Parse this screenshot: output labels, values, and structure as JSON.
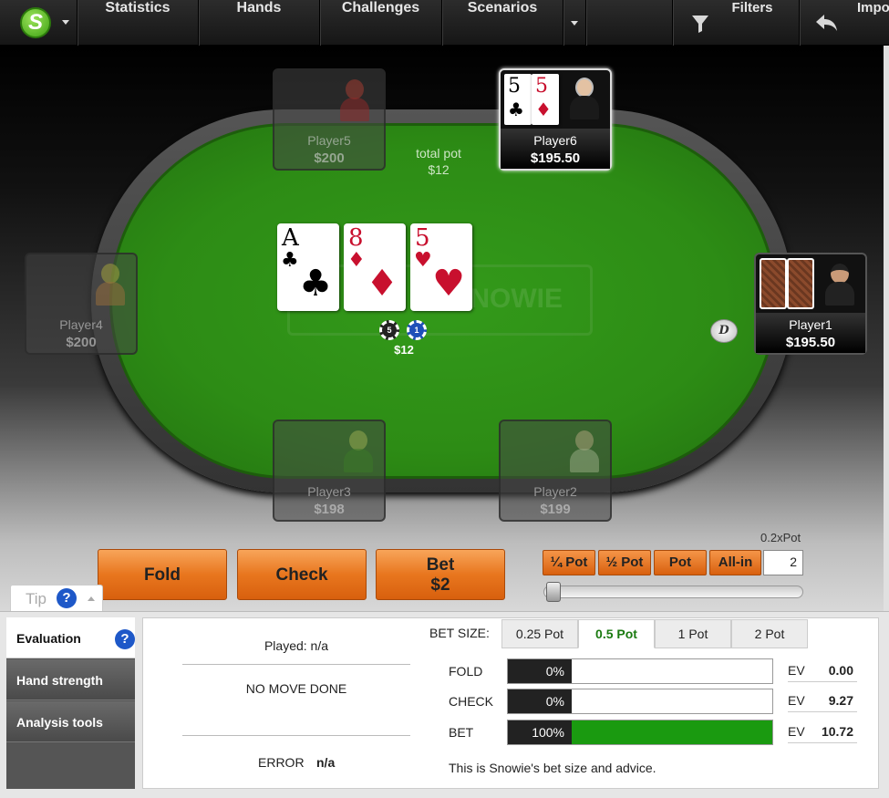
{
  "nav": {
    "logo": "S",
    "items": [
      "Statistics",
      "Hands",
      "Challenges",
      "Scenarios"
    ],
    "filters": "Filters",
    "import": "Impo"
  },
  "table": {
    "total_pot_label": "total pot",
    "total_pot_value": "$12",
    "watermark": "SNOWIE",
    "pot_chips_value": "$12",
    "chip_labels": [
      "5",
      "1"
    ],
    "dealer_button": "D",
    "board": [
      {
        "rank": "A",
        "suit": "♣",
        "color": "#000000"
      },
      {
        "rank": "8",
        "suit": "♦",
        "color": "#c8102e"
      },
      {
        "rank": "5",
        "suit": "♥",
        "color": "#c8102e"
      }
    ]
  },
  "players": {
    "p6": {
      "name": "Player6",
      "stack": "$195.50",
      "cards": [
        {
          "rank": "5",
          "suit": "♣"
        },
        {
          "rank": "5",
          "suit": "♦"
        }
      ]
    },
    "p5": {
      "name": "Player5",
      "stack": "$200"
    },
    "p4": {
      "name": "Player4",
      "stack": "$200"
    },
    "p1": {
      "name": "Player1",
      "stack": "$195.50"
    },
    "p3": {
      "name": "Player3",
      "stack": "$198"
    },
    "p2": {
      "name": "Player2",
      "stack": "$199"
    }
  },
  "actions": {
    "fold": "Fold",
    "check": "Check",
    "bet": "Bet",
    "bet_amount": "$2"
  },
  "bet_sizing": {
    "quarter": "¼ Pot",
    "half": "½ Pot",
    "pot": "Pot",
    "allin": "All-in",
    "input_value": "2",
    "pot_multiple": "0.2xPot",
    "slider_fraction": 0.01
  },
  "tip": {
    "label": "Tip",
    "help": "?"
  },
  "sidebar": {
    "items": [
      "Evaluation",
      "Hand strength",
      "Analysis tools"
    ],
    "help": "?"
  },
  "evaluation": {
    "played": "Played: n/a",
    "no_move": "NO MOVE DONE",
    "error_label": "ERROR",
    "error_value": "n/a",
    "bet_size_label": "BET SIZE:",
    "bet_size_tabs": [
      "0.25 Pot",
      "0.5 Pot",
      "1 Pot",
      "2 Pot"
    ],
    "selected_tab": "0.5 Pot",
    "rows": [
      {
        "action": "FOLD",
        "percent": "0%",
        "fraction": 0,
        "ev_label": "EV",
        "ev": "0.00"
      },
      {
        "action": "CHECK",
        "percent": "0%",
        "fraction": 0,
        "ev_label": "EV",
        "ev": "9.27"
      },
      {
        "action": "BET",
        "percent": "100%",
        "fraction": 1,
        "ev_label": "EV",
        "ev": "10.72"
      }
    ],
    "advice": "This is Snowie's bet size and advice."
  },
  "colors": {
    "felt": "#2d8c15",
    "action_orange": "#e8761e",
    "bet_fill": "#1a9a10",
    "help_blue": "#1e58c8"
  }
}
